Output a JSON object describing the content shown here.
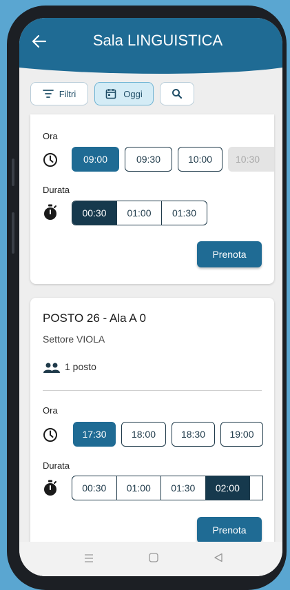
{
  "header": {
    "title": "Sala LINGUISTICA"
  },
  "toolbar": {
    "filters_label": "Filtri",
    "today_label": "Oggi"
  },
  "card1": {
    "time_label": "Ora",
    "times": [
      "09:00",
      "09:30",
      "10:00",
      "10:30"
    ],
    "duration_label": "Durata",
    "durations": [
      "00:30",
      "01:00",
      "01:30"
    ],
    "book_label": "Prenota"
  },
  "card2": {
    "title": "POSTO 26 - Ala A 0",
    "sector": "Settore VIOLA",
    "seats": "1 posto",
    "time_label": "Ora",
    "times": [
      "17:30",
      "18:00",
      "18:30",
      "19:00"
    ],
    "duration_label": "Durata",
    "durations": [
      "00:30",
      "01:00",
      "01:30",
      "02:00"
    ],
    "book_label": "Prenota"
  },
  "colors": {
    "primary": "#1f6b94",
    "dark": "#16394d",
    "background": "#5aa6d1"
  }
}
